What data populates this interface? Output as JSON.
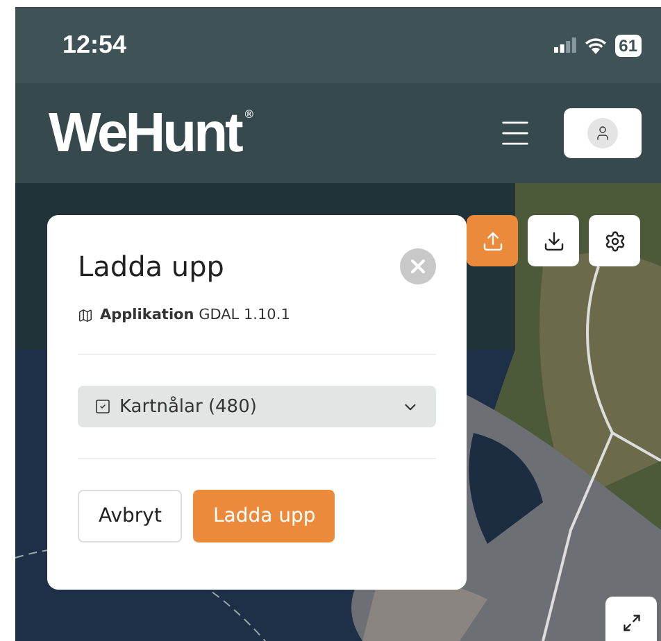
{
  "status_bar": {
    "time": "12:54",
    "battery": "61"
  },
  "header": {
    "logo": "WeHunt",
    "logo_mark": "®"
  },
  "map_toolbar": [
    {
      "kind": "upload",
      "selected": true
    },
    {
      "kind": "download",
      "selected": false
    },
    {
      "kind": "settings",
      "selected": false
    }
  ],
  "dialog": {
    "title": "Ladda upp",
    "app_label": "Applikation",
    "app_value": "GDAL 1.10.1",
    "select": {
      "value": "Kartnålar (480)"
    },
    "buttons": [
      {
        "label": "Avbryt",
        "kind": "secondary"
      },
      {
        "label": "Ladda upp",
        "kind": "primary"
      }
    ]
  }
}
